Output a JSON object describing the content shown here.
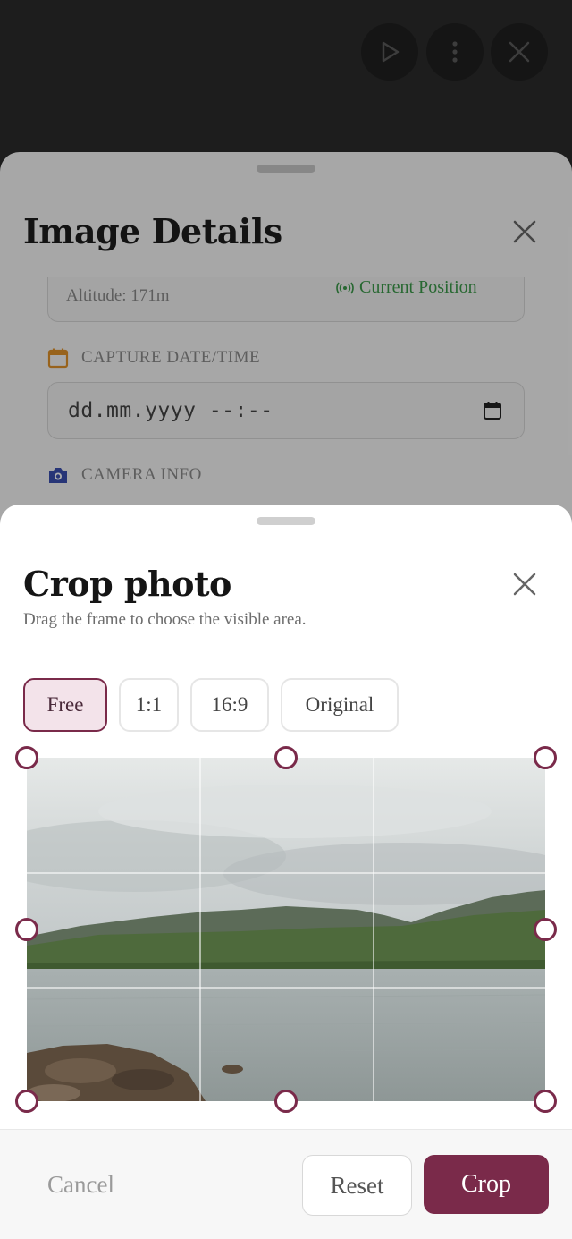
{
  "background_sheet": {
    "title": "Image Details",
    "location": {
      "altitude": "Altitude: 171m",
      "current_position_label": "Current Position"
    },
    "capture_date": {
      "section_label": "CAPTURE DATE/TIME",
      "value": "dd.mm.yyyy --:--"
    },
    "camera_info": {
      "section_label": "CAMERA INFO"
    }
  },
  "crop_sheet": {
    "title": "Crop photo",
    "subtitle": "Drag the frame to choose the visible area.",
    "aspect_options": [
      {
        "label": "Free",
        "selected": true
      },
      {
        "label": "1:1",
        "selected": false
      },
      {
        "label": "16:9",
        "selected": false
      },
      {
        "label": "Original",
        "selected": false
      }
    ],
    "footer": {
      "cancel_label": "Cancel",
      "reset_label": "Reset",
      "crop_label": "Crop"
    }
  },
  "colors": {
    "accent": "#7a2a4a",
    "accent_light": "#f3e3ea",
    "location_green": "#3c9a4a",
    "calendar_orange": "#e0922a",
    "camera_blue": "#3a4fb0"
  },
  "icons": {
    "top_play": "play-icon",
    "top_more": "more-vertical-icon",
    "top_close": "close-icon"
  }
}
